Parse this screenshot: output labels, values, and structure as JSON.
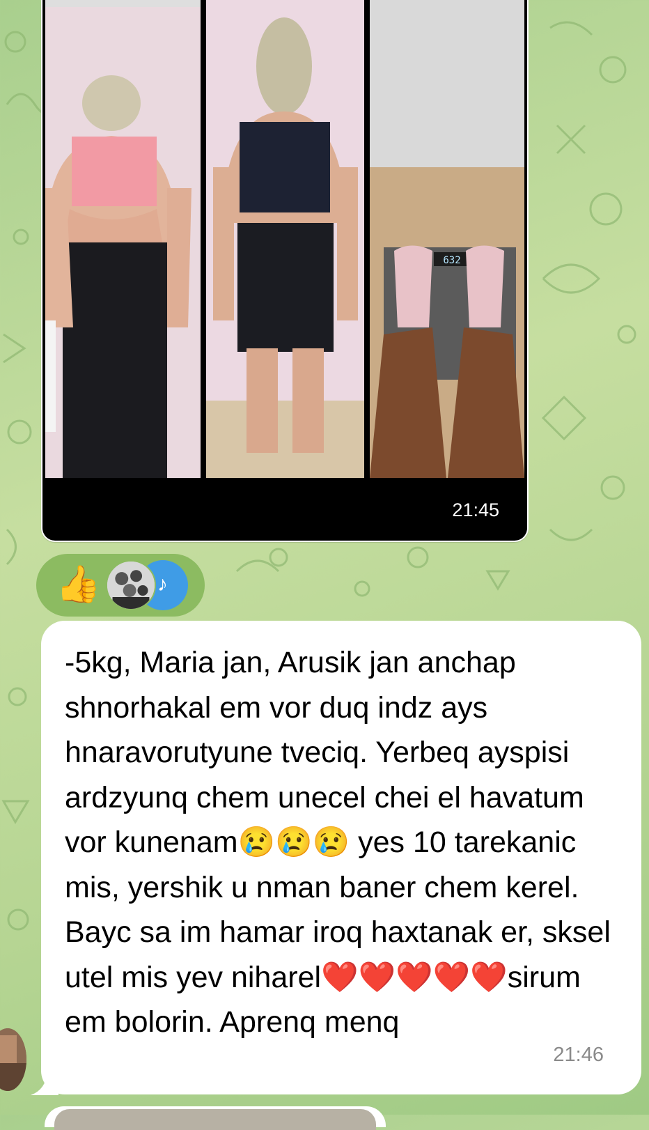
{
  "chat": {
    "wallpaper_color": "#b6d593",
    "media_message": {
      "time": "21:45",
      "photos": [
        {
          "name": "before-back-photo"
        },
        {
          "name": "after-back-photo"
        },
        {
          "name": "scale-photo",
          "scale_reading": "63.2"
        }
      ]
    },
    "reactions": {
      "emoji": "👍",
      "accent_color": "#3f9ce6"
    },
    "text_message": {
      "text": "-5kg, Maria jan, Arusik jan anchap shnorhakal em vor duq indz ays hnaravorutyune tveciq. Yerbeq ayspisi ardzyunq chem unecel chei el havatum vor kunenam😢😢😢 yes 10 tarekanic mis, yershik u nman baner chem kerel. Bayc sa im hamar iroq haxtanak er, sksel utel mis yev niharel❤️❤️❤️❤️❤️sirum em bolorin. Aprenq menq",
      "time": "21:46"
    }
  }
}
